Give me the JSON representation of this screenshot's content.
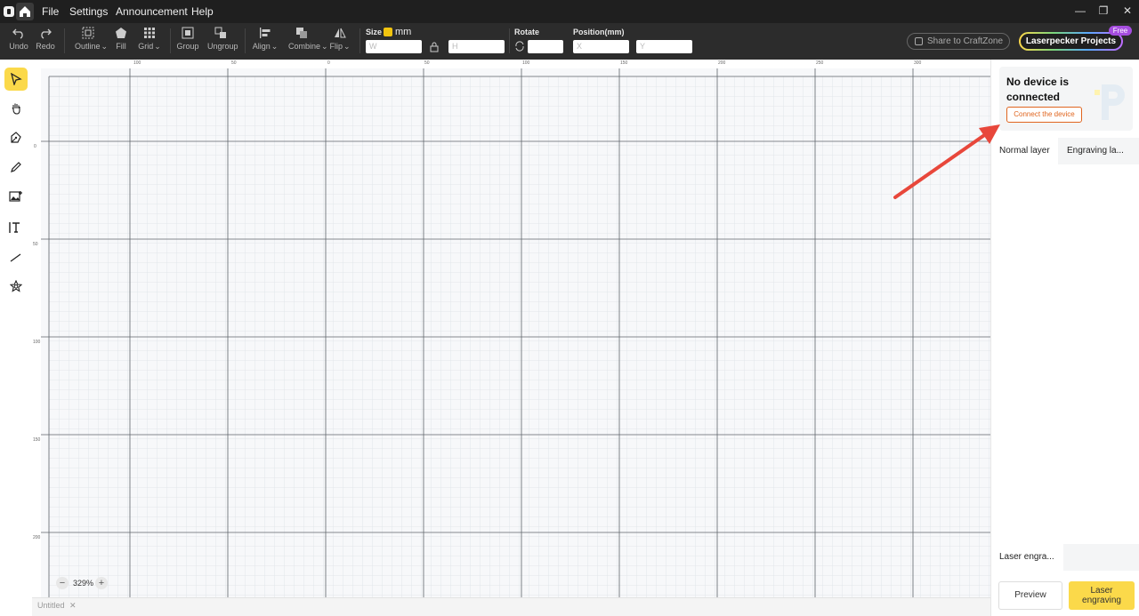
{
  "titlebar": {
    "menu": [
      "File",
      "Settings",
      "Announcement",
      "Help"
    ],
    "window_controls": [
      "—",
      "❐",
      "✕"
    ]
  },
  "toolbar": {
    "undo": "Undo",
    "redo": "Redo",
    "outline": "Outline",
    "fill": "Fill",
    "grid": "Grid",
    "group": "Group",
    "ungroup": "Ungroup",
    "align": "Align",
    "combine": "Combine",
    "flip": "Flip",
    "size_label": "Size",
    "unit": "mm",
    "w_label": "W",
    "h_label": "H",
    "rotate_label": "Rotate",
    "position_label": "Position(mm)",
    "x_label": "X",
    "y_label": "Y",
    "share": "Share to CraftZone",
    "projects": "Laserpecker Projects",
    "free_badge": "Free"
  },
  "rulers": {
    "h_ticks": [
      "100",
      "50",
      "0",
      "50",
      "100",
      "150",
      "200",
      "250",
      "300"
    ],
    "v_ticks": [
      "0",
      "50",
      "100",
      "150",
      "200"
    ]
  },
  "canvas": {
    "zoom": "329%",
    "doc_tab": "Untitled",
    "tab_close": "✕"
  },
  "right_panel": {
    "device_status": "No device is connected",
    "connect_button": "Connect the device",
    "layer_tabs": [
      "Normal layer",
      "Engraving la..."
    ],
    "mode_tab": "Laser engra...",
    "preview_button": "Preview",
    "engrave_button_line1": "Laser",
    "engrave_button_line2": "engraving"
  },
  "colors": {
    "accent": "#fbd94a",
    "connect": "#e0651f",
    "arrow": "#e8473b"
  }
}
